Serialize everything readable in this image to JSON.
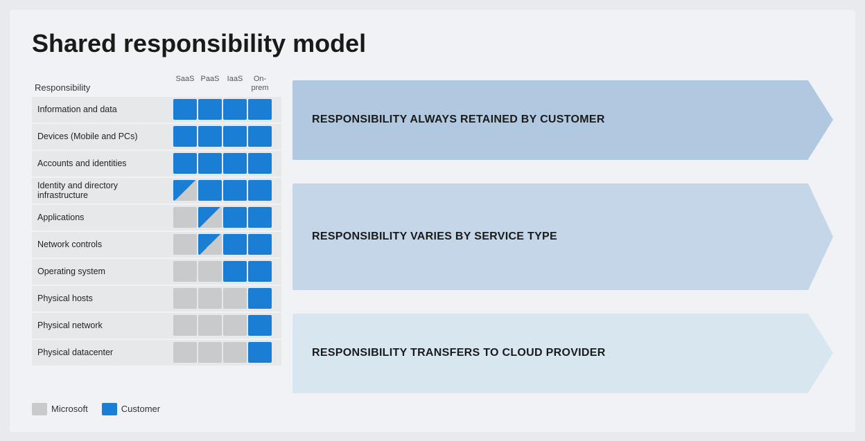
{
  "title": "Shared responsibility model",
  "table": {
    "header_label": "Responsibility",
    "col_headers": [
      "SaaS",
      "PaaS",
      "IaaS",
      "On-\nprem"
    ],
    "rows": [
      {
        "label": "Information and data",
        "cells": [
          "blue",
          "blue",
          "blue",
          "blue"
        ]
      },
      {
        "label": "Devices (Mobile and PCs)",
        "cells": [
          "blue",
          "blue",
          "blue",
          "blue"
        ]
      },
      {
        "label": "Accounts and identities",
        "cells": [
          "blue",
          "blue",
          "blue",
          "blue"
        ]
      },
      {
        "label": "Identity and directory infrastructure",
        "cells": [
          "diag-blue-gray",
          "blue",
          "blue",
          "blue"
        ]
      },
      {
        "label": "Applications",
        "cells": [
          "gray",
          "diag-blue-gray",
          "blue",
          "blue"
        ]
      },
      {
        "label": "Network controls",
        "cells": [
          "gray",
          "diag-blue-gray",
          "blue",
          "blue"
        ]
      },
      {
        "label": "Operating system",
        "cells": [
          "gray",
          "gray",
          "blue",
          "blue"
        ]
      },
      {
        "label": "Physical hosts",
        "cells": [
          "gray",
          "gray",
          "gray",
          "blue"
        ]
      },
      {
        "label": "Physical network",
        "cells": [
          "gray",
          "gray",
          "gray",
          "blue"
        ]
      },
      {
        "label": "Physical datacenter",
        "cells": [
          "gray",
          "gray",
          "gray",
          "blue"
        ]
      }
    ]
  },
  "arrows": [
    {
      "id": "arrow1",
      "text": "RESPONSIBILITY ALWAYS RETAINED BY CUSTOMER",
      "color": "blue-dark"
    },
    {
      "id": "arrow2",
      "text": "RESPONSIBILITY VARIES BY SERVICE TYPE",
      "color": "blue-mid"
    },
    {
      "id": "arrow3",
      "text": "RESPONSIBILITY TRANSFERS TO CLOUD PROVIDER",
      "color": "blue-light"
    }
  ],
  "legend": {
    "items": [
      {
        "label": "Microsoft",
        "color": "gray"
      },
      {
        "label": "Customer",
        "color": "blue"
      }
    ]
  }
}
